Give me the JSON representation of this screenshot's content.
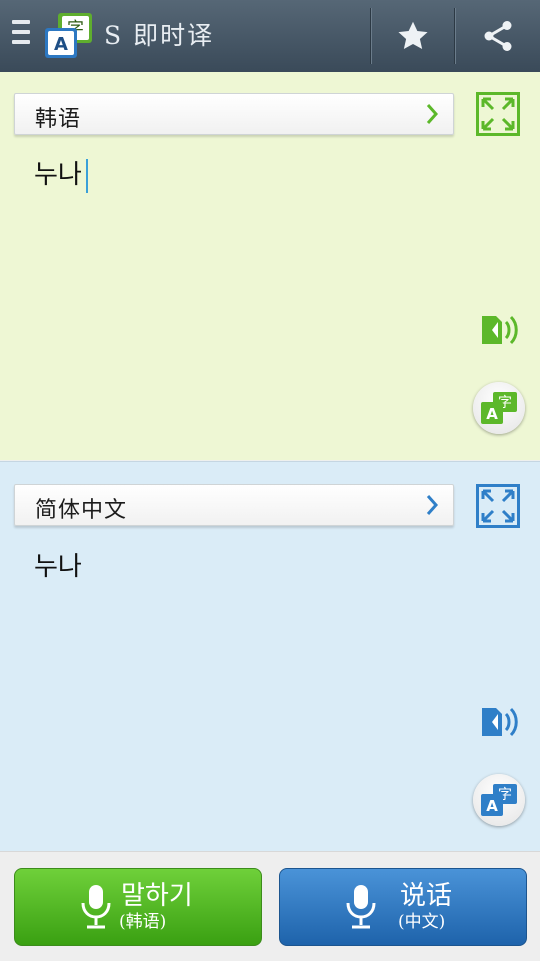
{
  "app": {
    "title": "S 即时译"
  },
  "source": {
    "language": "韩语",
    "text": "누나"
  },
  "target": {
    "language": "简体中文",
    "text": "누나"
  },
  "bottom": {
    "left": {
      "main": "말하기",
      "sub": "(韩语)"
    },
    "right": {
      "main": "说话",
      "sub": "(中文)"
    }
  },
  "logo": {
    "top_glyph": "字",
    "bottom_glyph": "A"
  },
  "icons": {
    "menu": "hamburger-icon",
    "star": "star-icon",
    "share": "share-icon",
    "expand": "expand-icon",
    "speak": "speaker-icon",
    "translate": "translate-icon",
    "mic": "microphone-icon",
    "chevron": "chevron-right-icon"
  },
  "colors": {
    "green": "#5cb82a",
    "blue": "#2f7fc8",
    "header": "#46576a",
    "src_bg": "#eef7d4",
    "dst_bg": "#daecf7"
  }
}
